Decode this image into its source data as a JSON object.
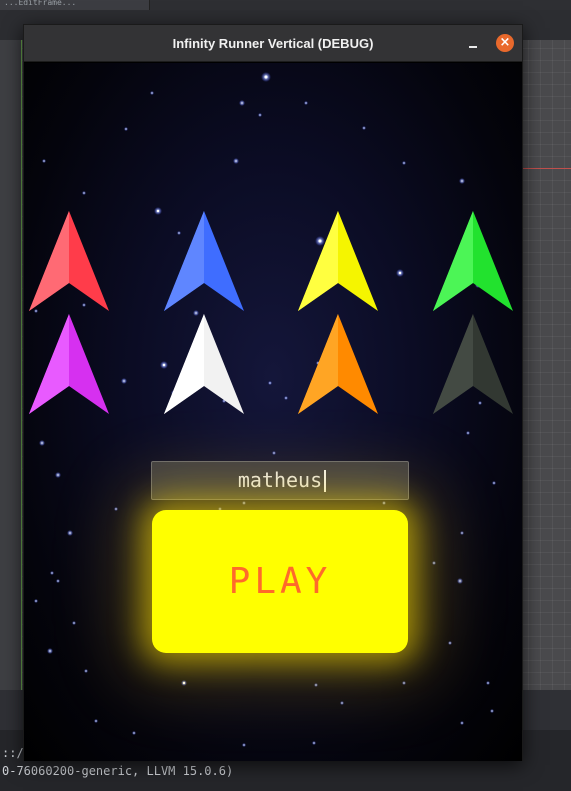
{
  "editor": {
    "tab_fragment": "...EditFrame...",
    "console_line1": "::/",
    "console_line2": "0-76060200-generic, LLVM 15.0.6)"
  },
  "window": {
    "title": "Infinity Runner Vertical (DEBUG)",
    "minimize_label": "",
    "close_label": "×"
  },
  "ships": [
    {
      "name": "red",
      "color": "#ff3c4a"
    },
    {
      "name": "blue",
      "color": "#3f6dff"
    },
    {
      "name": "yellow",
      "color": "#ffff10"
    },
    {
      "name": "green",
      "color": "#2ef23a"
    },
    {
      "name": "magenta",
      "color": "#e23cff"
    },
    {
      "name": "white",
      "color": "#ffffff"
    },
    {
      "name": "orange",
      "color": "#ff9a00"
    },
    {
      "name": "dark-gray",
      "color": "#3a3f3a"
    }
  ],
  "name_input": {
    "value": "matheus"
  },
  "play_button": {
    "label": "PLAY",
    "color": "#ffff00",
    "text_color": "#ff6a2a"
  }
}
